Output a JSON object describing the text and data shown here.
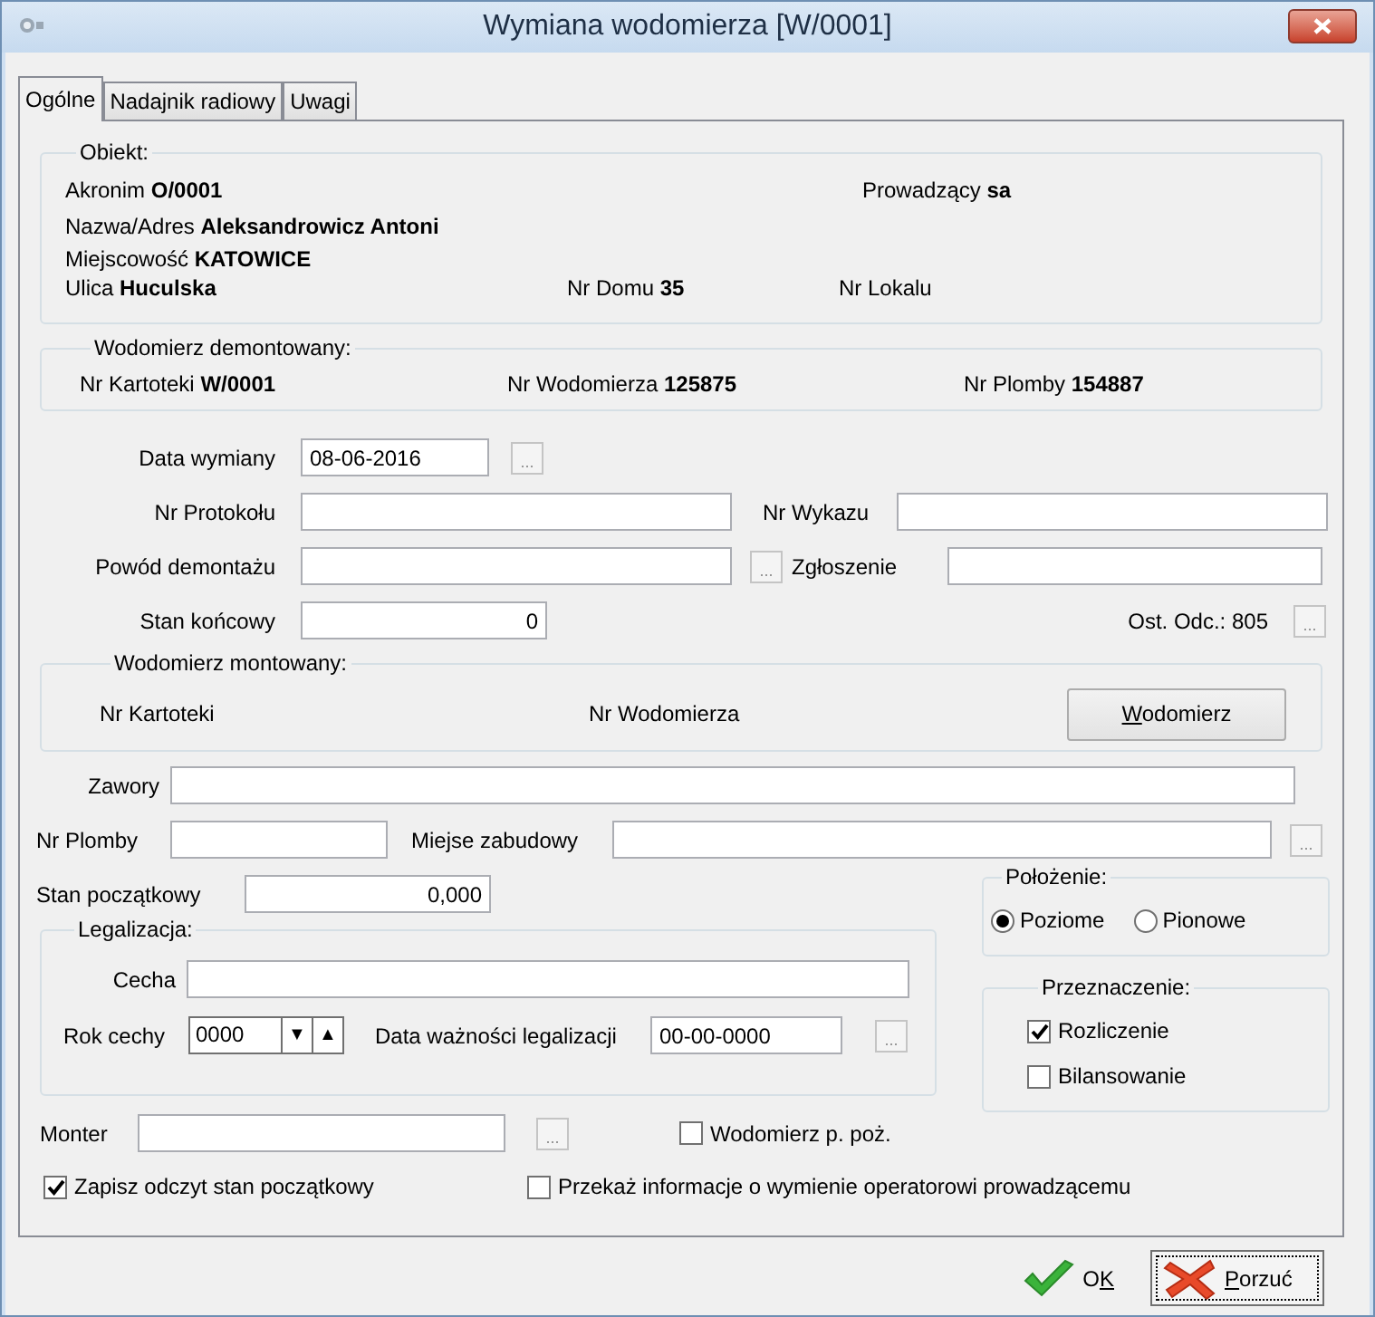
{
  "window": {
    "title": "Wymiana wodomierza [W/0001]"
  },
  "tabs": [
    {
      "label": "Ogólne",
      "selected": true
    },
    {
      "label": "Nadajnik radiowy",
      "selected": false
    },
    {
      "label": "Uwagi",
      "selected": false
    }
  ],
  "obiekt": {
    "title": "Obiekt:",
    "akronim": {
      "label": "Akronim",
      "value": "O/0001"
    },
    "prowadzacy": {
      "label": "Prowadzący",
      "value": "sa"
    },
    "nazwa": {
      "label": "Nazwa/Adres",
      "value": "Aleksandrowicz Antoni"
    },
    "miejscowosc": {
      "label": "Miejscowość",
      "value": "KATOWICE"
    },
    "ulica": {
      "label": "Ulica",
      "value": "Huculska"
    },
    "nr_domu": {
      "label": "Nr Domu",
      "value": "35"
    },
    "nr_lokalu": {
      "label": "Nr Lokalu"
    }
  },
  "demontowany": {
    "title": "Wodomierz demontowany:",
    "items": [
      {
        "label": "Nr Kartoteki",
        "value": "W/0001"
      },
      {
        "label": "Nr Wodomierza",
        "value": "125875"
      },
      {
        "label": "Nr Plomby",
        "value": "154887"
      }
    ]
  },
  "data_wymiany": {
    "label": "Data wymiany",
    "value": "08-06-2016",
    "browse": "..."
  },
  "nr_protokolu": {
    "label": "Nr Protokołu"
  },
  "nr_wykazu": {
    "label": "Nr Wykazu"
  },
  "powod": {
    "label": "Powód demontażu",
    "browse": "..."
  },
  "zgloszenie": {
    "label": "Zgłoszenie"
  },
  "stan_koncowy": {
    "label": "Stan końcowy",
    "value": "0"
  },
  "ost_odc": {
    "text": "Ost. Odc.: 805",
    "browse": "..."
  },
  "montowany": {
    "title": "Wodomierz montowany:",
    "items": [
      "Nr Kartoteki",
      "Nr Wodomierza"
    ],
    "button": {
      "key": "W",
      "post": "odomierz"
    }
  },
  "zawory": {
    "label": "Zawory"
  },
  "nr_plomby": {
    "label": "Nr Plomby"
  },
  "miejsce": {
    "label": "Miejse zabudowy",
    "browse": "..."
  },
  "stan_poczatkowy": {
    "label": "Stan początkowy",
    "value": "0,000"
  },
  "legalizacja": {
    "title": "Legalizacja:",
    "cecha": {
      "label": "Cecha"
    },
    "rok": {
      "label": "Rok cechy",
      "value": "0000",
      "spin": [
        "▼",
        "▲"
      ]
    },
    "data_waznosci": {
      "label": "Data ważności legalizacji",
      "value": "00-00-0000",
      "browse": "..."
    }
  },
  "monter": {
    "label": "Monter",
    "browse": "..."
  },
  "ppoz": {
    "label": "Wodomierz p. poż.",
    "checked": false
  },
  "polozenie": {
    "title": "Położenie:",
    "options": [
      {
        "label": "Poziome",
        "selected": true
      },
      {
        "label": "Pionowe",
        "selected": false
      }
    ]
  },
  "przeznaczenie": {
    "title": "Przeznaczenie:",
    "options": [
      {
        "label": "Rozliczenie",
        "checked": true
      },
      {
        "label": "Bilansowanie",
        "checked": false
      }
    ]
  },
  "zapisz": {
    "label": "Zapisz odczyt stan początkowy",
    "checked": true
  },
  "przekaz": {
    "label": "Przekaż informacje o wymienie operatorowi prowadzącemu",
    "checked": false
  },
  "ok": {
    "pre": "O",
    "key": "K"
  },
  "porzuc": {
    "key": "P",
    "post": "orzuć"
  }
}
